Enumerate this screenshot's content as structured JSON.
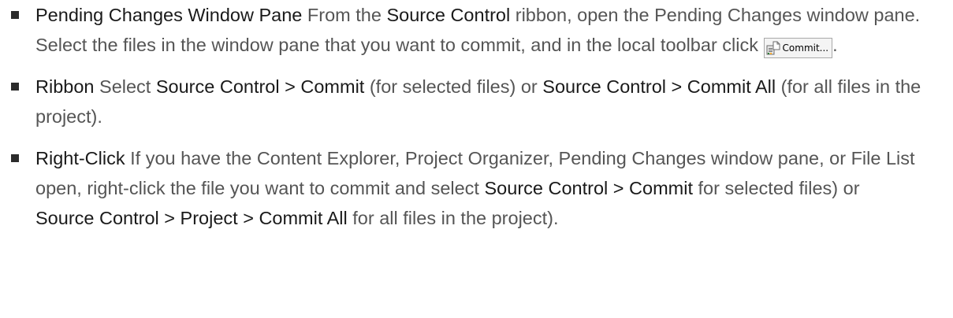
{
  "items": [
    {
      "segments": [
        {
          "text": "Pending Changes Window Pane",
          "bold": true
        },
        {
          "text": " From the ",
          "bold": false
        },
        {
          "text": "Source Control",
          "bold": true
        },
        {
          "text": " ribbon, open the Pending Changes window pane. Select the files in the window pane that you want to commit, and in the local toolbar click ",
          "bold": false
        },
        {
          "button": "Commit..."
        },
        {
          "text": ".",
          "bold": false
        }
      ]
    },
    {
      "segments": [
        {
          "text": "Ribbon",
          "bold": true
        },
        {
          "text": " Select ",
          "bold": false
        },
        {
          "text": "Source Control > Commit",
          "bold": true
        },
        {
          "text": " (for selected files) or ",
          "bold": false
        },
        {
          "text": "Source Control > Commit All",
          "bold": true
        },
        {
          "text": " (for all files in the project).",
          "bold": false
        }
      ]
    },
    {
      "segments": [
        {
          "text": "Right-Click",
          "bold": true
        },
        {
          "text": " If you have the Content Explorer, Project Organizer, Pending Changes window pane, or File List open, right-click the file you want to commit and select ",
          "bold": false
        },
        {
          "text": "Source Control > Commit",
          "bold": true
        },
        {
          "text": "  for selected files) or ",
          "bold": false
        },
        {
          "text": "Source Control > Project > Commit All",
          "bold": true
        },
        {
          "text": "  for all files in the project).",
          "bold": false
        }
      ]
    }
  ]
}
